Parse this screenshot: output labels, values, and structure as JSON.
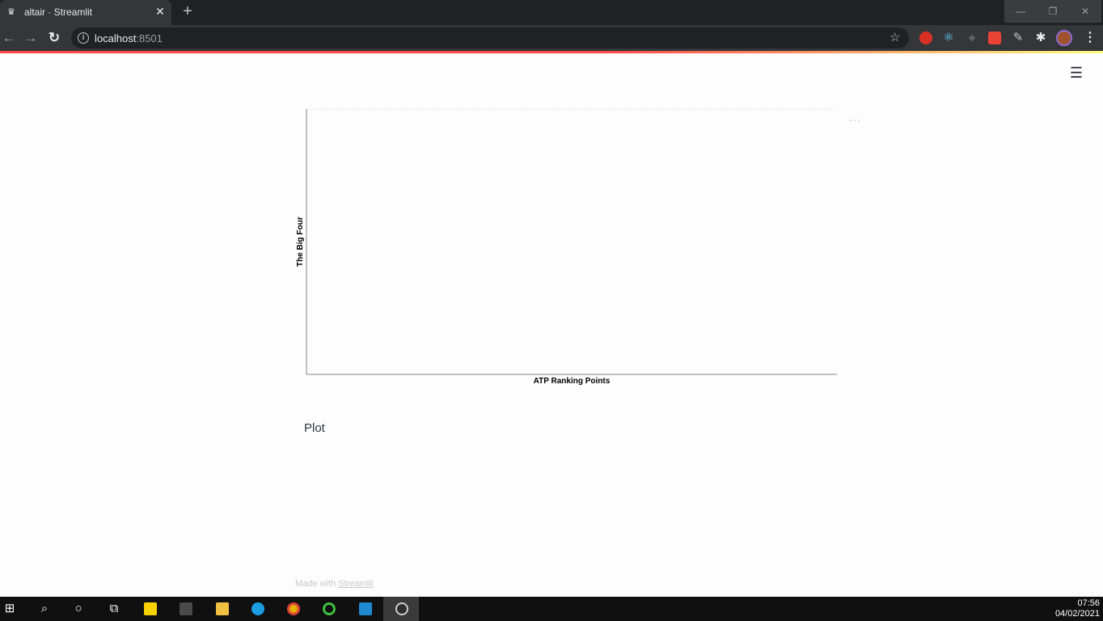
{
  "browser": {
    "tab_title": "altair · Streamlit",
    "new_tab_label": "+",
    "url_host": "localhost",
    "url_port": ":8501",
    "window_controls": {
      "minimize": "—",
      "maximize": "❐",
      "close": "✕"
    }
  },
  "page": {
    "plot_caption": "Plot",
    "footer_prefix": "Made with ",
    "footer_link": "Streamlit",
    "actions_label": "···"
  },
  "chart_data": {
    "type": "bar",
    "categories": [],
    "values": [],
    "title": "",
    "xlabel": "ATP Ranking Points",
    "ylabel": "The Big Four",
    "grid": false
  },
  "taskbar": {
    "time": "07:56",
    "date": "04/02/2021"
  },
  "colors": {
    "accent": "#ff4b4b",
    "accent_end": "#fffd80",
    "chrome_dark": "#202124",
    "chrome_toolbar": "#35363a",
    "page_bg": "#fdfdfe",
    "text": "#31333f"
  }
}
